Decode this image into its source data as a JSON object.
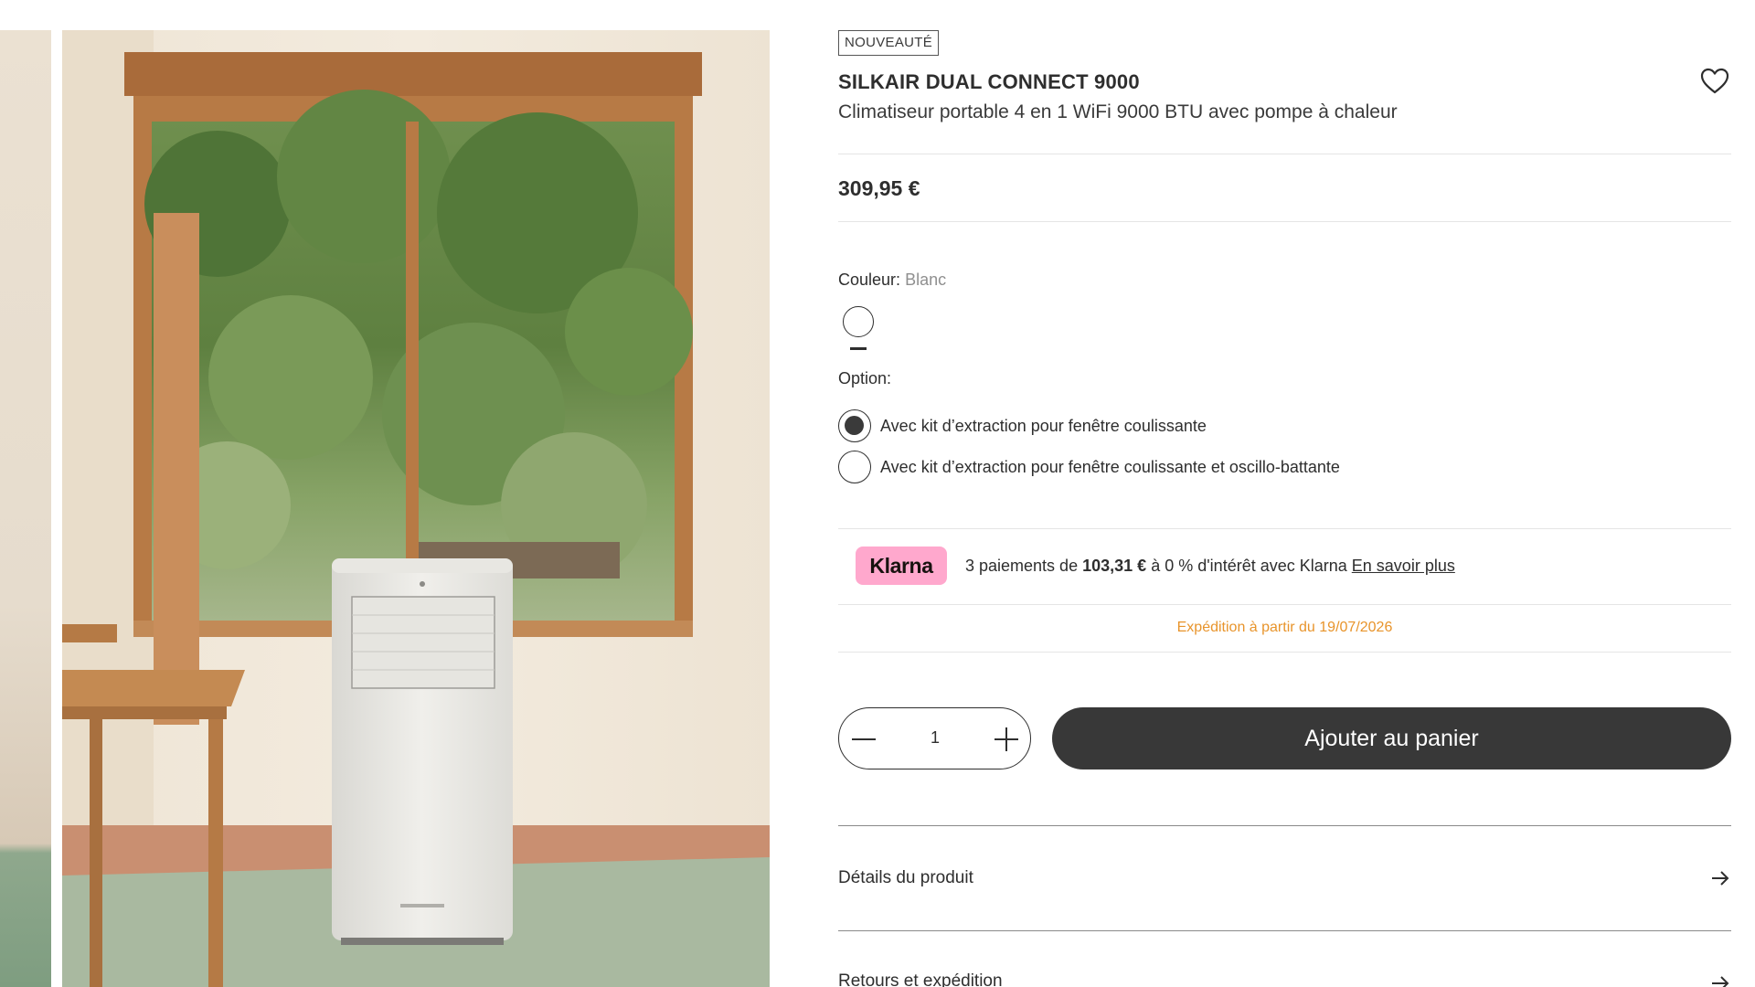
{
  "product": {
    "badge": "NOUVEAUTÉ",
    "name": "SILKAIR DUAL CONNECT 9000",
    "subtitle": "Climatiseur portable 4 en 1 WiFi 9000 BTU avec pompe à chaleur",
    "price": "309,95 €",
    "wishlist_icon": "heart-icon"
  },
  "color": {
    "label": "Couleur:",
    "value": "Blanc",
    "swatches": [
      {
        "name": "Blanc",
        "hex": "#ffffff",
        "selected": true
      }
    ]
  },
  "option": {
    "label": "Option:",
    "choices": [
      {
        "label": "Avec kit d’extraction pour fenêtre coulissante",
        "selected": true
      },
      {
        "label": "Avec kit d’extraction pour fenêtre coulissante et oscillo-battante",
        "selected": false
      }
    ]
  },
  "klarna": {
    "logo": "Klarna",
    "text_before": "3 paiements de",
    "amount": "103,31 €",
    "text_after": "à 0 % d'intérêt avec Klarna",
    "link": "En savoir plus",
    "logo_color": "#ffa8cd"
  },
  "shipping": {
    "text": "Expédition à partir du 19/07/2026",
    "color": "#e8942b"
  },
  "quantity": {
    "value": "1",
    "minus_icon": "minus-icon",
    "plus_icon": "plus-icon"
  },
  "cart": {
    "button_label": "Ajouter au panier",
    "button_color": "#383838"
  },
  "accordion": [
    {
      "label": "Détails du produit",
      "icon": "arrow-right-icon"
    },
    {
      "label": "Retours et expédition",
      "icon": "arrow-right-icon"
    }
  ]
}
